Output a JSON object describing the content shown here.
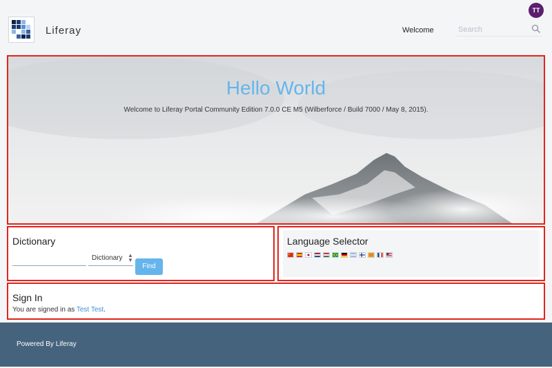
{
  "header": {
    "avatar_initials": "TT",
    "brand": "Liferay",
    "nav_welcome": "Welcome",
    "search_placeholder": "Search"
  },
  "hero": {
    "title": "Hello World",
    "subtitle": "Welcome to Liferay Portal Community Edition 7.0.0 CE M5 (Wilberforce / Build 7000 / May 8, 2015)."
  },
  "dictionary": {
    "title": "Dictionary",
    "select_value": "Dictionary",
    "find_label": "Find"
  },
  "language_selector": {
    "title": "Language Selector",
    "flags": [
      "china-flag-icon",
      "spain-flag-icon",
      "japan-flag-icon",
      "netherlands-flag-icon",
      "hungary-flag-icon",
      "brazil-flag-icon",
      "germany-flag-icon",
      "israel-flag-icon",
      "finland-flag-icon",
      "catalonia-flag-icon",
      "france-flag-icon",
      "usa-flag-icon"
    ]
  },
  "sign_in": {
    "title": "Sign In",
    "text_prefix": "You are signed in as",
    "user_link": "Test Test",
    "text_suffix": "."
  },
  "footer": {
    "text": "Powered By Liferay"
  },
  "colors": {
    "accent": "#65b5ec",
    "portlet_border": "#e2231a",
    "footer_bg": "#45637c",
    "avatar_bg": "#5b1f6e"
  }
}
